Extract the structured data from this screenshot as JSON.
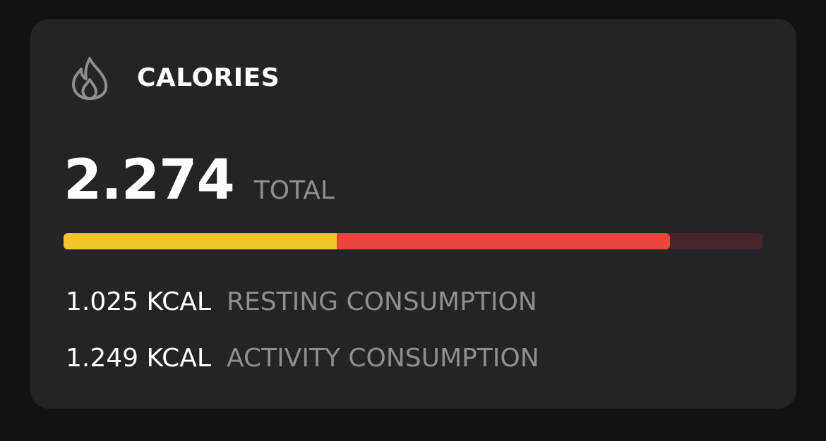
{
  "card": {
    "title": "CALORIES",
    "icon": "flame-icon",
    "total": {
      "value": "2.274",
      "label": "TOTAL"
    },
    "bar": {
      "resting_fraction": 0.391,
      "activity_fraction": 0.477,
      "colors": {
        "resting": "#f3c52c",
        "activity": "#e8453d",
        "track": "#4a2529"
      }
    },
    "metrics": [
      {
        "value": "1.025 KCAL",
        "label": "RESTING CONSUMPTION"
      },
      {
        "value": "1.249 KCAL",
        "label": "ACTIVITY CONSUMPTION"
      }
    ]
  }
}
